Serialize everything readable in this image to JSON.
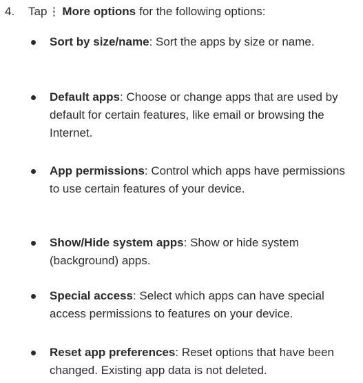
{
  "step": {
    "number": "4.",
    "prefix": "Tap",
    "icon": "more-options-vertical-dots-icon",
    "label": "More options",
    "suffix": "for the following options:"
  },
  "items": [
    {
      "term": "Sort by size/name",
      "description": ": Sort the apps by size or name."
    },
    {
      "term": "Default apps",
      "description": ": Choose or change apps that are used by default for certain features, like email or browsing the Internet."
    },
    {
      "term": "App permissions",
      "description": ": Control which apps have permissions to use certain features of your device."
    },
    {
      "term": "Show/Hide system apps",
      "description": ": Show or hide system (background) apps."
    },
    {
      "term": "Special access",
      "description": ": Select which apps can have special access permissions to features on your device."
    },
    {
      "term": "Reset app preferences",
      "description": ": Reset options that have been changed. Existing app data is not deleted."
    }
  ]
}
